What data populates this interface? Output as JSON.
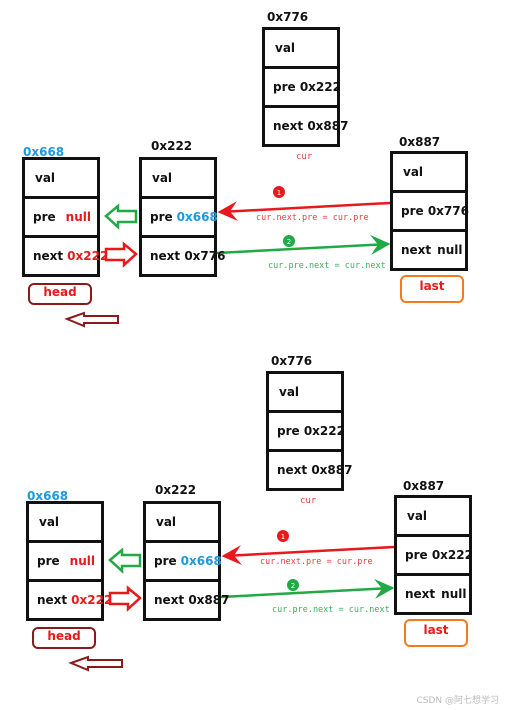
{
  "panels": [
    {
      "cur": {
        "addr": "0x776",
        "val": "val",
        "pre": "pre 0x222",
        "next": "next 0x887",
        "label": "cur"
      },
      "head": {
        "addr": "0x668",
        "val": "val",
        "pre_label": "pre",
        "pre_value": "null",
        "next_label": "next",
        "next_value": "0x222",
        "tag": "head"
      },
      "mid": {
        "addr": "0x222",
        "val": "val",
        "pre_label": "pre",
        "pre_value": "0x668",
        "next": "next 0x776"
      },
      "last": {
        "addr": "0x887",
        "val": "val",
        "pre": "pre 0x776",
        "next_label": "next",
        "next_value": "null",
        "tag": "last"
      },
      "step1": {
        "num": "1",
        "code": "cur.next.pre = cur.pre"
      },
      "step2": {
        "num": "2",
        "code": "cur.pre.next = cur.next"
      }
    },
    {
      "cur": {
        "addr": "0x776",
        "val": "val",
        "pre": "pre 0x222",
        "next": "next 0x887",
        "label": "cur"
      },
      "head": {
        "addr": "0x668",
        "val": "val",
        "pre_label": "pre",
        "pre_value": "null",
        "next_label": "next",
        "next_value": "0x222",
        "tag": "head"
      },
      "mid": {
        "addr": "0x222",
        "val": "val",
        "pre_label": "pre",
        "pre_value": "0x668",
        "next": "next 0x887"
      },
      "last": {
        "addr": "0x887",
        "val": "val",
        "pre": "pre 0x222",
        "next_label": "next",
        "next_value": "null",
        "tag": "last"
      },
      "step1": {
        "num": "1",
        "code": "cur.next.pre = cur.pre"
      },
      "step2": {
        "num": "2",
        "code": "cur.pre.next = cur.next"
      }
    }
  ],
  "watermark": "CSDN @阿七想学习",
  "colors": {
    "red": "#e8191c",
    "green": "#22a845",
    "blue": "#1a9ae0",
    "darkred": "#8b1a1a",
    "orange": "#f47a20"
  }
}
